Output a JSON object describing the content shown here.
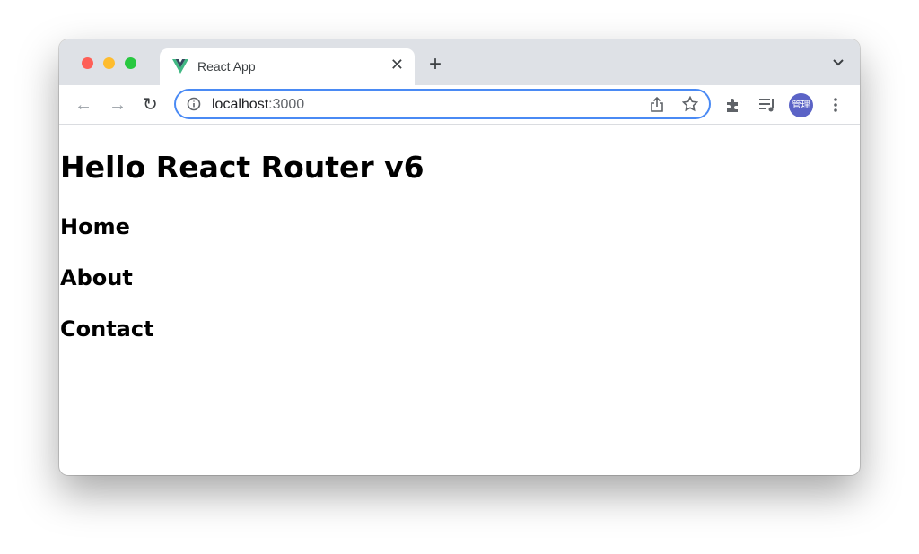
{
  "browser": {
    "tab_title": "React App",
    "tab_favicon": "vue-logo-icon",
    "url_host": "localhost",
    "url_port": ":3000",
    "profile_label": "管理",
    "colors": {
      "close": "#fe5f57",
      "minimize": "#febc2e",
      "maximize": "#28c840",
      "focus_ring": "#4a8af4",
      "avatar": "#5b63c6"
    }
  },
  "page": {
    "title": "Hello React Router v6",
    "links": [
      {
        "label": "Home"
      },
      {
        "label": "About"
      },
      {
        "label": "Contact"
      }
    ]
  }
}
